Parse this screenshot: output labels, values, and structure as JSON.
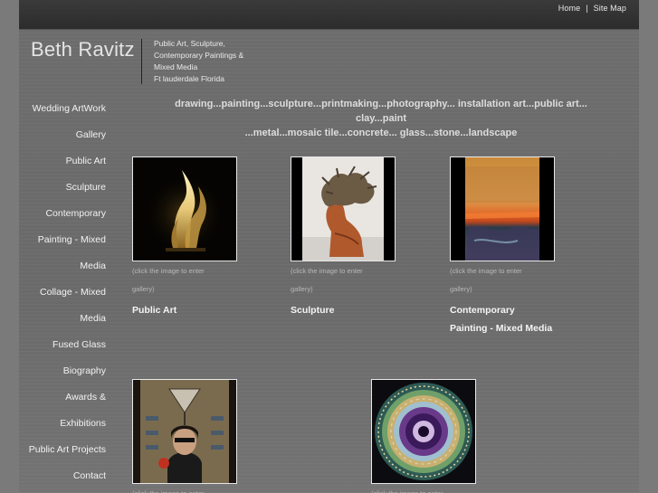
{
  "header": {
    "links": [
      "Home",
      "Site Map"
    ],
    "separator": "|"
  },
  "brand": {
    "name": "Beth Ravitz",
    "tagline": [
      "Public Art, Sculpture,",
      "Contemporary Paintings &",
      "Mixed Media",
      "Ft lauderdale Florida"
    ]
  },
  "keywords": [
    "drawing...painting...sculpture...printmaking...photography... installation art...public art... clay...paint",
    "...metal...mosaic tile...concrete... glass...stone...landscape"
  ],
  "nav": [
    "Wedding ArtWork",
    "Gallery",
    "Public Art",
    "Sculpture",
    "Contemporary",
    "Painting - Mixed",
    "Media",
    "Collage - Mixed",
    "Media",
    "Fused Glass",
    "Biography",
    "Awards &",
    "Exhibitions",
    "Public Art Projects",
    "Contact"
  ],
  "galleries": [
    {
      "title_lines": [
        "Public Art"
      ],
      "caption_lines": [
        "(click the image to enter",
        "gallery)"
      ],
      "image": "flame-sculpture-photo"
    },
    {
      "title_lines": [
        "Sculpture"
      ],
      "caption_lines": [
        "(click the image to enter",
        "gallery)"
      ],
      "image": "bust-sculpture-photo"
    },
    {
      "title_lines": [
        "Contemporary",
        "Painting - Mixed Media"
      ],
      "caption_lines": [
        "(click the image to enter",
        "gallery)"
      ],
      "image": "abstract-painting-photo"
    },
    {
      "title_lines": [],
      "caption_lines": [
        "(click the image to enter"
      ],
      "image": "collage-portrait-photo"
    },
    {
      "title_lines": [],
      "caption_lines": [
        "(click the image to enter"
      ],
      "image": "fused-glass-photo"
    }
  ]
}
